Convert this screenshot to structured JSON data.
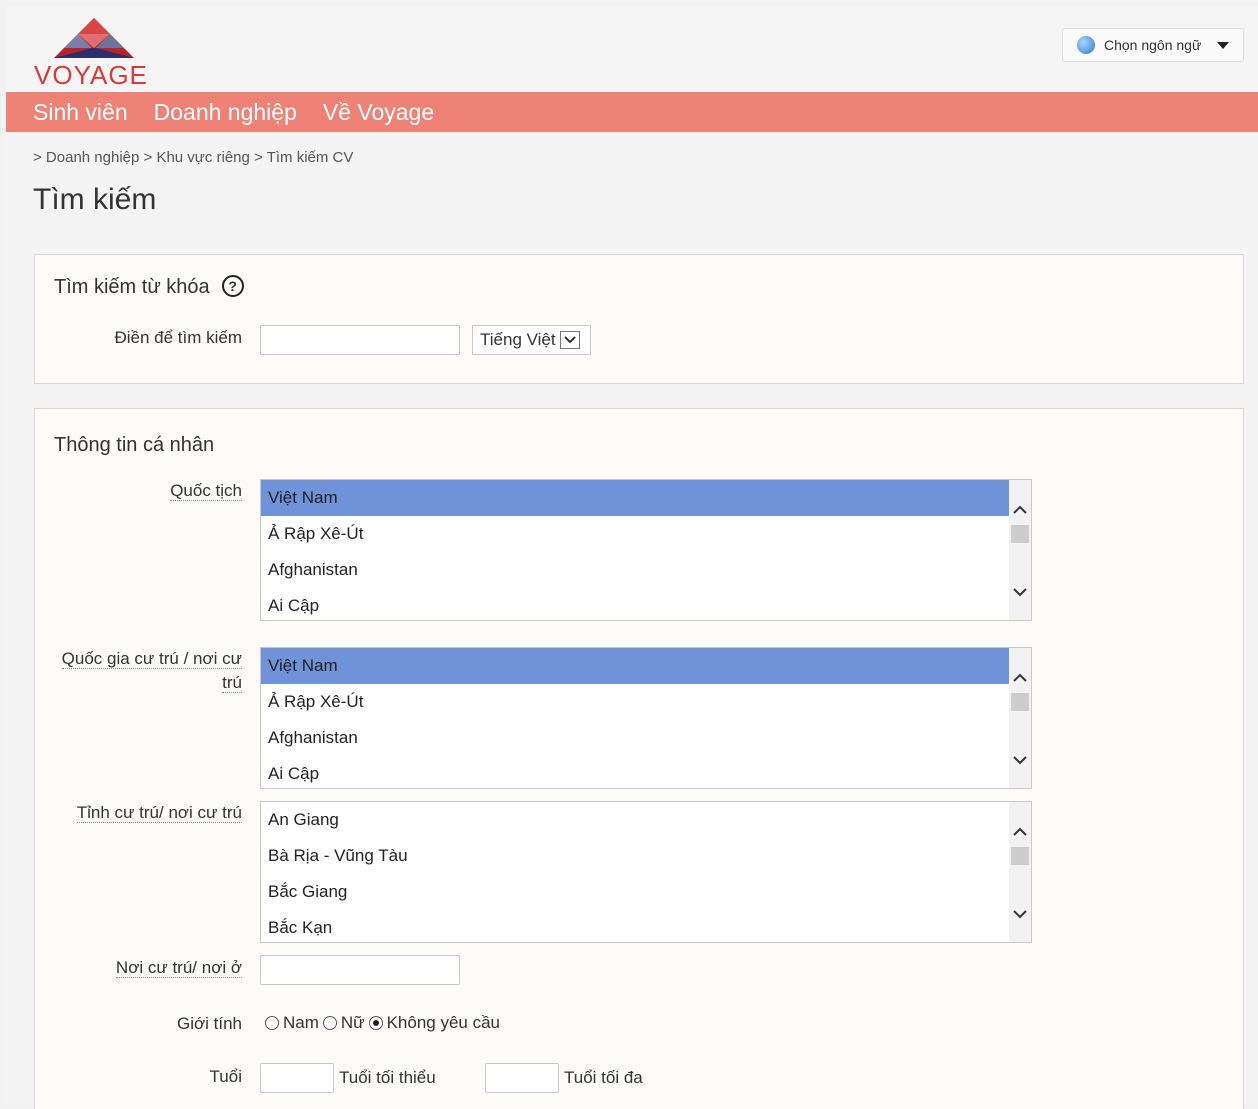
{
  "header": {
    "logo_text": "VOYAGE",
    "language_button": "Chọn ngôn ngữ"
  },
  "nav": [
    "Sinh viên",
    "Doanh nghiệp",
    "Về Voyage"
  ],
  "breadcrumb": [
    "> Doanh nghiệp",
    "> Khu vực riêng",
    "> Tìm kiếm CV"
  ],
  "page_title": "Tìm kiếm",
  "keyword_section": {
    "title": "Tìm kiếm từ khóa",
    "help_symbol": "?",
    "field_label": "Điền để tìm kiếm",
    "field_value": "",
    "language_select": "Tiếng Việt"
  },
  "personal_section": {
    "title": "Thông tin cá nhân",
    "nationality": {
      "label": "Quốc tịch",
      "options": [
        "Việt Nam",
        "Ả Rập Xê-Út",
        "Afghanistan",
        "Ai Cập"
      ],
      "selected": "Việt Nam"
    },
    "residence_country": {
      "label": "Quốc gia cư trú / nơi cư trú",
      "options": [
        "Việt Nam",
        "Ả Rập Xê-Út",
        "Afghanistan",
        "Ai Cập"
      ],
      "selected": "Việt Nam"
    },
    "province": {
      "label": "Tỉnh cư trú/ nơi cư trú",
      "options": [
        "An Giang",
        "Bà Rịa - Vũng Tàu",
        "Bắc Giang",
        "Bắc Kạn"
      ]
    },
    "residence_place": {
      "label": "Nơi cư trú/ nơi ở",
      "value": ""
    },
    "gender": {
      "label": "Giới tính",
      "options": [
        "Nam",
        "Nữ",
        "Không yêu cầu"
      ],
      "selected": "Không yêu cầu"
    },
    "age": {
      "label": "Tuổi",
      "min_label": "Tuổi tối thiểu",
      "max_label": "Tuổi tối đa",
      "min_value": "",
      "max_value": ""
    }
  },
  "colors": {
    "nav_bg": "#ee8277",
    "selected_option": "#7092d8",
    "logo_red": "#d93a3a"
  }
}
